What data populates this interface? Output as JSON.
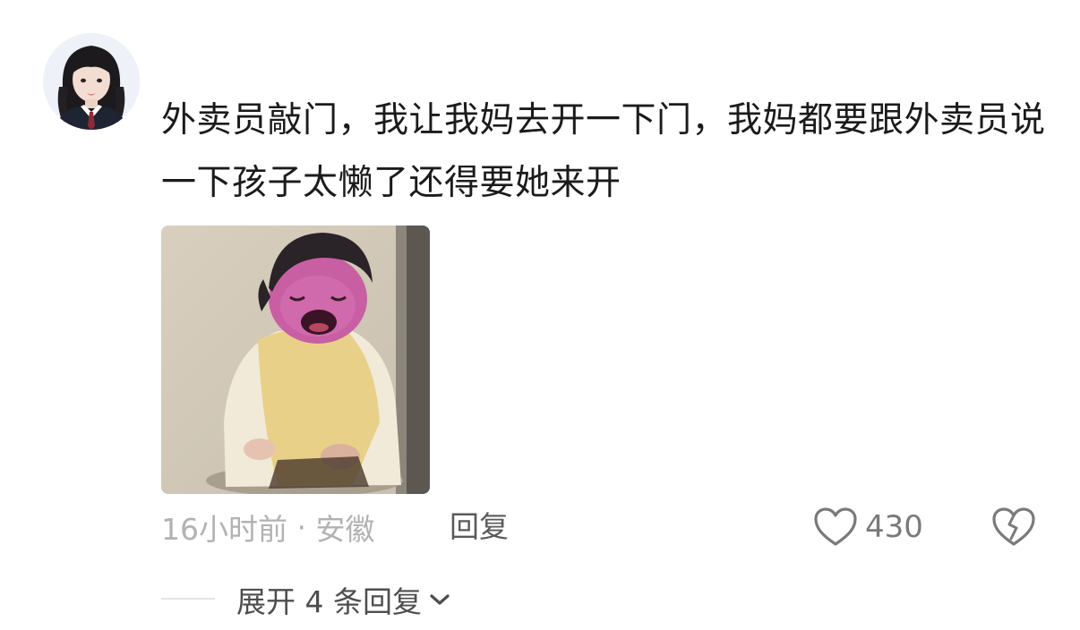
{
  "comment": {
    "text": "外卖员敲门，我让我妈去开一下门，我妈都要跟外卖员说一下孩子太懒了还得要她来开",
    "time": "16小时前",
    "separator": " · ",
    "location": "安徽",
    "reply_label": "回复",
    "like_count": "430",
    "expand_label": "展开 4 条回复"
  },
  "icons": {
    "like": "heart-outline-icon",
    "dislike": "broken-heart-icon",
    "expand": "chevron-down-icon"
  },
  "colors": {
    "text": "#1b1b1b",
    "meta": "#b2b2b2",
    "reply": "#5a5a5a",
    "icon": "#7a7a7a"
  }
}
